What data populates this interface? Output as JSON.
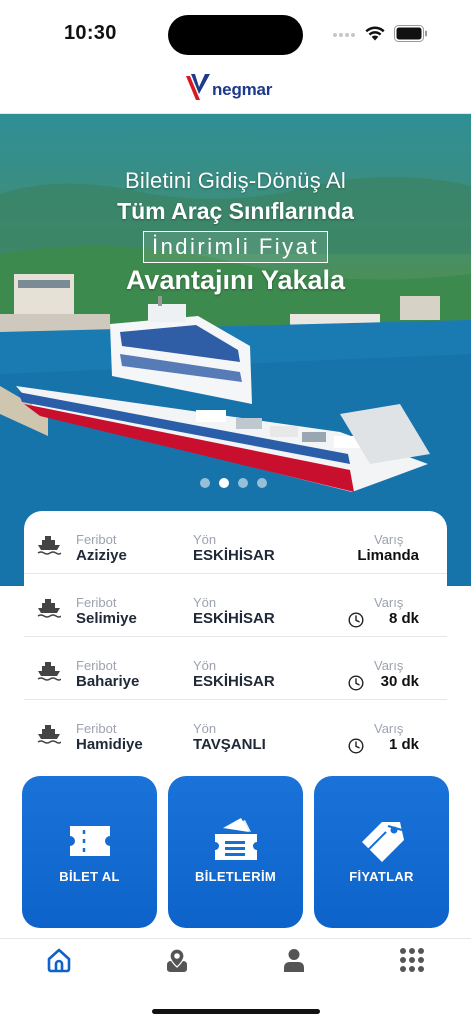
{
  "status_bar": {
    "time": "10:30"
  },
  "header": {
    "logo_text": "negmar"
  },
  "hero": {
    "line1": "Biletini Gidiş-Dönüş Al",
    "line2": "Tüm Araç Sınıflarında",
    "line3": "İndirimli Fiyat",
    "line4": "Avantajını Yakala",
    "slide_count": 4,
    "active_slide": 2
  },
  "schedule": {
    "labels": {
      "ferry": "Feribot",
      "direction": "Yön",
      "arrival": "Varış"
    },
    "rows": [
      {
        "ferry": "Aziziye",
        "direction": "ESKİHİSAR",
        "arrival": "Limanda",
        "show_clock": false
      },
      {
        "ferry": "Selimiye",
        "direction": "ESKİHİSAR",
        "arrival": "8 dk",
        "show_clock": true
      },
      {
        "ferry": "Bahariye",
        "direction": "ESKİHİSAR",
        "arrival": "30 dk",
        "show_clock": true
      },
      {
        "ferry": "Hamidiye",
        "direction": "TAVŞANLI",
        "arrival": "1 dk",
        "show_clock": true
      }
    ]
  },
  "actions": {
    "buy_ticket": "BİLET AL",
    "my_tickets": "BİLETLERİM",
    "prices": "FİYATLAR"
  },
  "tabs": [
    {
      "icon": "home-icon",
      "active": true
    },
    {
      "icon": "map-pin-icon",
      "active": false
    },
    {
      "icon": "user-icon",
      "active": false
    },
    {
      "icon": "grid-icon",
      "active": false
    }
  ],
  "colors": {
    "primary": "#0d63c9",
    "accent_red": "#d71920",
    "text_dark": "#1f2937",
    "muted": "#9ca3af"
  }
}
